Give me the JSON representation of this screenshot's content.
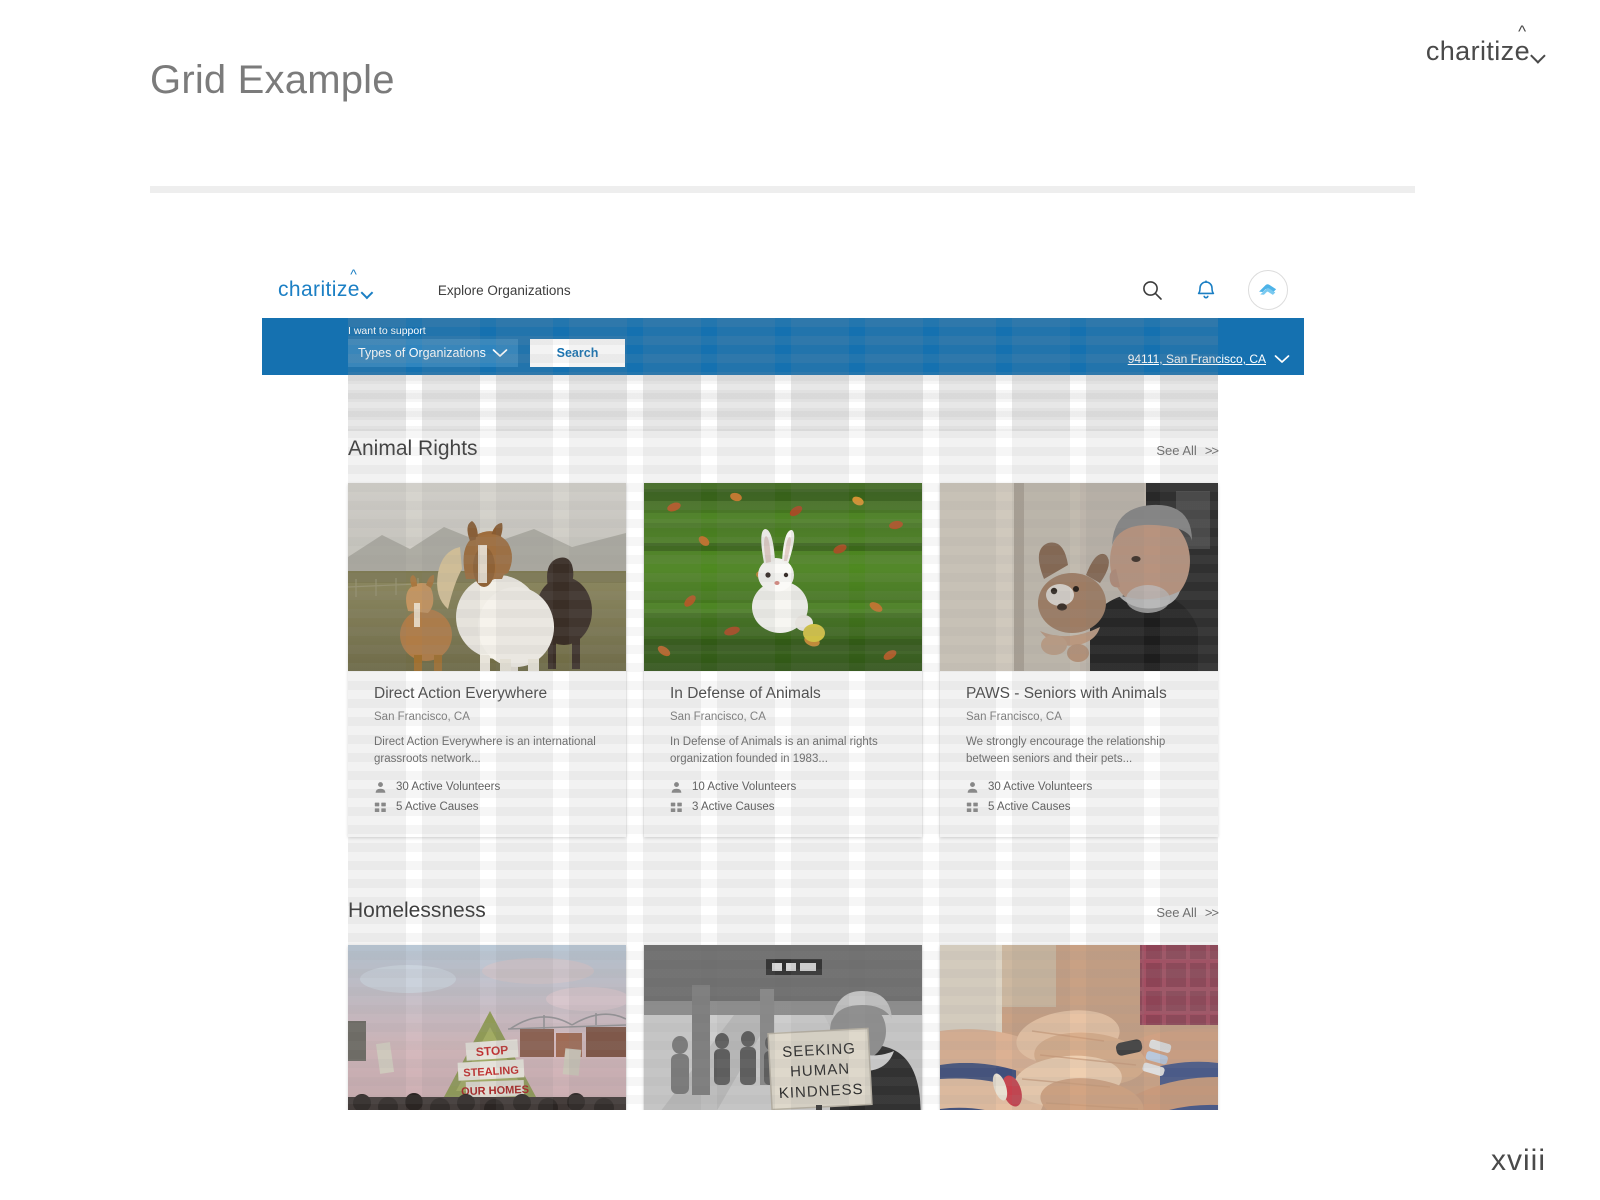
{
  "slide": {
    "title": "Grid Example",
    "brand": "charitize",
    "page_number": "xviii"
  },
  "app": {
    "logo": "charitize",
    "nav_link": "Explore Organizations",
    "icons": {
      "search": "search-icon",
      "notifications": "bell-icon",
      "avatar": "user-avatar"
    },
    "search_band": {
      "support_label": "I want to support",
      "dropdown_value": "Types of Organizations",
      "search_button": "Search",
      "location": "94111, San Francisco, CA"
    },
    "sections": [
      {
        "title": "Animal Rights",
        "see_all": "See All",
        "see_all_arrows": ">>",
        "cards": [
          {
            "image": "three-horses-in-field",
            "title": "Direct Action Everywhere",
            "location": "San Francisco, CA",
            "description": "Direct Action Everywhere is an international grassroots network...",
            "volunteers": "30 Active Volunteers",
            "causes": "5 Active Causes"
          },
          {
            "image": "white-rabbit-on-grass",
            "title": "In Defense of Animals",
            "location": "San Francisco, CA",
            "description": "In Defense of Animals is an animal rights organization founded in 1983...",
            "volunteers": "10 Active Volunteers",
            "causes": "3 Active Causes"
          },
          {
            "image": "senior-man-with-dog",
            "title": "PAWS - Seniors with Animals",
            "location": "San Francisco, CA",
            "description": "We strongly encourage the relationship between seniors and their pets...",
            "volunteers": "30 Active Volunteers",
            "causes": "5 Active Causes"
          }
        ]
      },
      {
        "title": "Homelessness",
        "see_all": "See All",
        "see_all_arrows": ">>",
        "cards": [
          {
            "image": "housing-protest-tent"
          },
          {
            "image": "seeking-human-kindness-sign"
          },
          {
            "image": "stacked-hands-together"
          }
        ]
      }
    ]
  },
  "colors": {
    "brand_blue": "#1571b0",
    "logo_blue": "#1b7fc4",
    "dropdown_blue": "#2f85bf",
    "title_gray": "#7b7b7b",
    "divider_gray": "#eeeeee"
  }
}
